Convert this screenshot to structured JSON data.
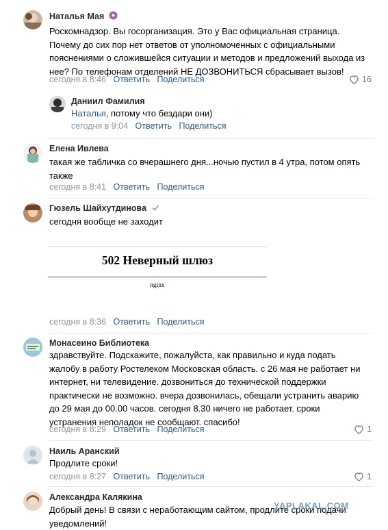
{
  "comments": [
    {
      "author": "Наталья Мая",
      "text": "Роскомнадзор. Вы госорганизация. Это у Вас официальная страница. Почему до сих пор нет ответов от уполномоченных с официальными пояснениями о сложившейся ситуации и методов и предложений выхода из нее? По телефонам отделений НЕ ДОЗВОНИТЬСЯ сбрасывает вызов!",
      "time": "сегодня в 8:46",
      "reply": "Ответить",
      "share": "Поделиться",
      "likes": "16"
    },
    {
      "author": "Даниил Фамилия",
      "mention": "Наталья",
      "text": ", потому что бездари они)",
      "time": "сегодня в 9:04",
      "reply": "Ответить",
      "share": "Поделиться"
    },
    {
      "author": "Елена Ивлева",
      "text": "такая же табличка со вчерашнего дня...ночью пустил в 4 утра, потом опять также",
      "time": "сегодня в 8:41",
      "reply": "Ответить",
      "share": "Поделиться"
    },
    {
      "author": "Гюзель Шайхутдинова",
      "text": "сегодня вообще не заходит",
      "embed_error": "502 Неверный шлюз",
      "embed_server": "nginx",
      "time": "сегодня в 8:36",
      "reply": "Ответить",
      "share": "Поделиться"
    },
    {
      "author": "Монасеино Библиотека",
      "text": "здравствуйте. Подскажите, пожалуйста, как правильно и куда подать жалобу в работу Ростелеком Московская область. с 26 мая не работает ни интернет, ни телевидение. дозвониться до технической поддержки практически не возможно. вчера дозвонилась, обещали устранить аварию до 29 мая до 00.00 часов. сегодня 8.30 ничего не работает. сроки устранения неполадок не сообщают. спасибо!",
      "time": "сегодня в 8:29",
      "reply": "Ответить",
      "share": "Поделиться",
      "likes": "1"
    },
    {
      "author": "Наиль Аранский",
      "text": "Продлите сроки!",
      "time": "сегодня в 8:27",
      "reply": "Ответить",
      "share": "Поделиться",
      "likes": "1"
    },
    {
      "author": "Александра Калякина",
      "text": "Добрый день! В связи с неработающим сайтом, продлите сроки подачи уведомлений!"
    }
  ],
  "watermark": "YAPLAKAL.COM",
  "colors": {
    "link": "#2a5885",
    "meta": "#8a96a3",
    "divider": "#e7e8ec"
  },
  "icons": {
    "like": "heart-icon",
    "verified": "checkmark-icon"
  }
}
